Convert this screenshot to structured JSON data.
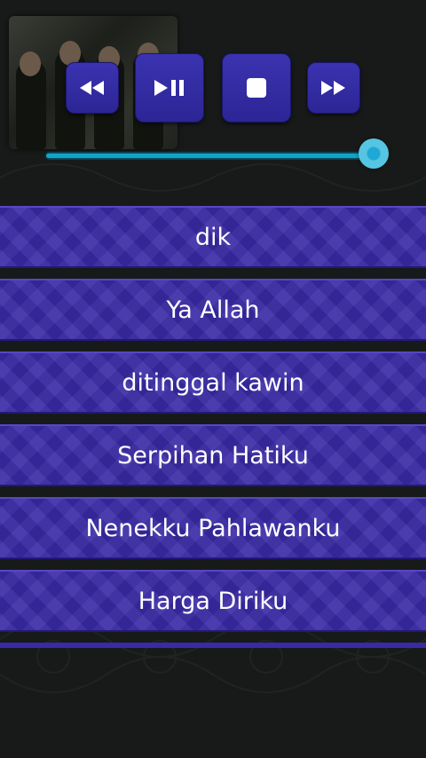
{
  "player": {
    "controls": [
      {
        "name": "rewind",
        "icon": "rewind-icon"
      },
      {
        "name": "play-pause",
        "icon": "play-pause-icon"
      },
      {
        "name": "stop",
        "icon": "stop-icon"
      },
      {
        "name": "fast-forward",
        "icon": "fast-forward-icon"
      }
    ],
    "progress": 1.0,
    "accent_color": "#12a4c8",
    "button_color": "#3128a3"
  },
  "songs": [
    {
      "title": "dik"
    },
    {
      "title": "Ya Allah"
    },
    {
      "title": "ditinggal kawin"
    },
    {
      "title": "Serpihan Hatiku"
    },
    {
      "title": "Nenekku Pahlawanku"
    },
    {
      "title": "Harga Diriku"
    }
  ],
  "list_color": "#3a2aa6"
}
